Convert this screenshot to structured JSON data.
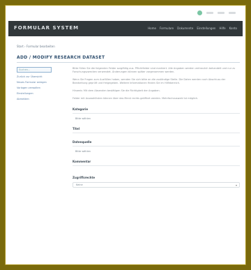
{
  "header": {
    "logo": "FORMULAR SYSTEM",
    "nav": [
      "Home",
      "Formulare",
      "Dokumente",
      "Einstellungen",
      "Hilfe",
      "Konto"
    ]
  },
  "breadcrumb": "Start › Formular bearbeiten",
  "page_title": "ADD / MODIFY RESEARCH DATASET",
  "sidebar": {
    "search_placeholder": "Suchen...",
    "links": [
      "Zurück zur Übersicht",
      "Neues Formular anlegen",
      "Vorlagen verwalten",
      "Einstellungen",
      "Abmelden"
    ]
  },
  "main": {
    "para1": "Bitte füllen Sie die folgenden Felder sorgfältig aus. Pflichtfelder sind markiert. Alle Angaben werden vertraulich behandelt und nur zu Forschungszwecken verwendet. Änderungen können später vorgenommen werden.",
    "para2": "Wenn Sie Fragen zum Ausfüllen haben, wenden Sie sich bitte an die zuständige Stelle. Die Daten werden nach Abschluss der Bearbeitung geprüft und freigegeben. Weitere Informationen finden Sie im Hilfebereich.",
    "para3": "Hinweis: Mit dem Absenden bestätigen Sie die Richtigkeit der Angaben.",
    "para4": "Felder mit Auswahllisten können über das Menü rechts geöffnet werden. Mehrfachauswahl ist möglich.",
    "fields": [
      {
        "label": "Kategorie",
        "value": "Bitte wählen"
      },
      {
        "label": "Titel",
        "value": ""
      },
      {
        "label": "Datenquelle",
        "value": "Bitte wählen"
      },
      {
        "label": "Kommentar",
        "value": ""
      },
      {
        "label": "Zugriffsrechte",
        "value": "Keine"
      }
    ]
  }
}
